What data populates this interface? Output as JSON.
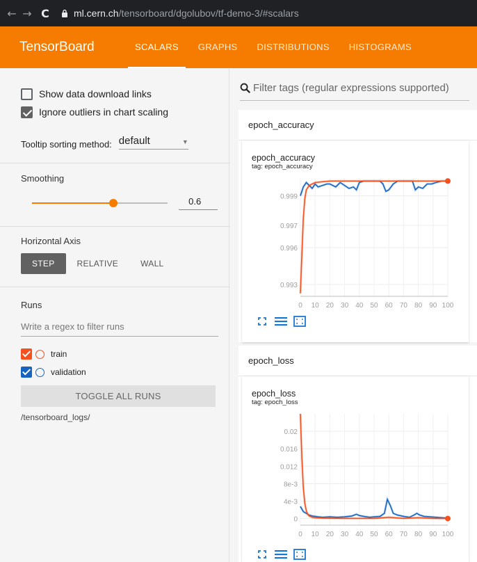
{
  "browser": {
    "back_icon": "←",
    "forward_icon": "→",
    "reload_icon": "C",
    "url_host": "ml.cern.ch",
    "url_path": "/tensorboard/dgolubov/tf-demo-3/#scalars"
  },
  "header": {
    "title": "TensorBoard",
    "tabs": [
      {
        "label": "SCALARS",
        "active": true
      },
      {
        "label": "GRAPHS",
        "active": false
      },
      {
        "label": "DISTRIBUTIONS",
        "active": false
      },
      {
        "label": "HISTOGRAMS",
        "active": false
      }
    ],
    "accent_color": "#f57c00"
  },
  "sidebar": {
    "show_download_links": {
      "label": "Show data download links",
      "checked": false
    },
    "ignore_outliers": {
      "label": "Ignore outliers in chart scaling",
      "checked": true
    },
    "tooltip_sorting": {
      "label": "Tooltip sorting method:",
      "value": "default"
    },
    "smoothing": {
      "label": "Smoothing",
      "value": "0.6",
      "fraction": 0.6
    },
    "horizontal_axis": {
      "label": "Horizontal Axis",
      "options": [
        {
          "label": "STEP",
          "active": true
        },
        {
          "label": "RELATIVE",
          "active": false
        },
        {
          "label": "WALL",
          "active": false
        }
      ]
    },
    "runs": {
      "label": "Runs",
      "filter_placeholder": "Write a regex to filter runs",
      "items": [
        {
          "name": "train",
          "color": "#f4511e",
          "checked": true
        },
        {
          "name": "validation",
          "color": "#1565c0",
          "checked": true
        }
      ],
      "toggle_label": "TOGGLE ALL RUNS",
      "logdir": "/tensorboard_logs/"
    }
  },
  "main": {
    "search_placeholder": "Filter tags (regular expressions supported)",
    "groups": [
      {
        "title": "epoch_accuracy",
        "chart_title": "epoch_accuracy",
        "chart_tag": "tag: epoch_accuracy"
      },
      {
        "title": "epoch_loss",
        "chart_title": "epoch_loss",
        "chart_tag": "tag: epoch_loss"
      }
    ]
  },
  "chart_data": [
    {
      "type": "line",
      "title": "epoch_accuracy",
      "subtitle": "tag: epoch_accuracy",
      "xlim": [
        0,
        100
      ],
      "x_ticks": [
        "0",
        "10",
        "20",
        "30",
        "40",
        "50",
        "60",
        "70",
        "80",
        "90",
        "100"
      ],
      "ylim": [
        0.9922,
        1.0002
      ],
      "y_ticks": [
        "0.999",
        "0.997",
        "0.996",
        "0.993"
      ],
      "y_tick_values": [
        0.999,
        0.997,
        0.9955,
        0.993
      ],
      "series": [
        {
          "name": "train",
          "color": "#f4511e",
          "x": [
            0,
            1,
            2,
            3,
            4,
            6,
            8,
            10,
            15,
            20,
            30,
            40,
            50,
            60,
            70,
            80,
            90,
            100
          ],
          "y": [
            0.9924,
            0.995,
            0.9975,
            0.9988,
            0.9994,
            0.9997,
            0.9998,
            0.9999,
            0.99995,
            1.0,
            1.0,
            1.0,
            1.0,
            1.0,
            1.0,
            1.0,
            1.0,
            1.0
          ]
        },
        {
          "name": "validation",
          "color": "#1565c0",
          "x": [
            0,
            2,
            4,
            6,
            8,
            10,
            12,
            15,
            18,
            20,
            24,
            27,
            30,
            33,
            36,
            38,
            40,
            43,
            47,
            50,
            54,
            56,
            58,
            60,
            63,
            66,
            70,
            73,
            76,
            78,
            80,
            83,
            86,
            89,
            92,
            96,
            100
          ],
          "y": [
            0.999,
            0.9996,
            0.9999,
            0.9997,
            0.9995,
            0.9998,
            0.9996,
            0.9997,
            0.9998,
            0.9998,
            0.9996,
            0.9999,
            0.9997,
            0.9995,
            0.9996,
            0.9994,
            0.9999,
            1.0,
            1.0,
            1.0,
            1.0,
            0.9998,
            0.9993,
            0.9994,
            0.9998,
            1.0,
            1.0,
            1.0,
            1.0,
            0.9994,
            0.9996,
            0.9995,
            0.9998,
            0.9998,
            0.9999,
            1.0,
            1.0
          ]
        }
      ]
    },
    {
      "type": "line",
      "title": "epoch_loss",
      "subtitle": "tag: epoch_loss",
      "xlim": [
        0,
        100
      ],
      "x_ticks": [
        "0",
        "10",
        "20",
        "30",
        "40",
        "50",
        "60",
        "70",
        "80",
        "90",
        "100"
      ],
      "ylim": [
        -0.0015,
        0.024
      ],
      "y_ticks": [
        "0.02",
        "0.016",
        "0.012",
        "8e-3",
        "4e-3",
        "0"
      ],
      "y_tick_values": [
        0.02,
        0.016,
        0.012,
        0.008,
        0.004,
        0.0
      ],
      "series": [
        {
          "name": "train",
          "color": "#f4511e",
          "x": [
            0,
            1,
            2,
            3,
            4,
            5,
            6,
            8,
            10,
            15,
            20,
            30,
            40,
            50,
            60,
            70,
            80,
            90,
            100
          ],
          "y": [
            0.024,
            0.014,
            0.007,
            0.0035,
            0.0018,
            0.001,
            0.0006,
            0.0003,
            0.0002,
            0.0001,
            8e-05,
            5e-05,
            5e-05,
            5e-05,
            0.0003,
            5e-05,
            0.0002,
            5e-05,
            2e-05
          ]
        },
        {
          "name": "validation",
          "color": "#1565c0",
          "x": [
            0,
            2,
            4,
            6,
            8,
            10,
            12,
            15,
            20,
            25,
            30,
            35,
            38,
            40,
            43,
            47,
            50,
            54,
            57,
            59,
            61,
            63,
            66,
            70,
            74,
            77,
            79,
            81,
            84,
            88,
            92,
            96,
            100
          ],
          "y": [
            0.0028,
            0.0016,
            0.0012,
            0.0008,
            0.0006,
            0.0005,
            0.0004,
            0.0003,
            0.0004,
            0.0003,
            0.0004,
            0.0006,
            0.001,
            0.0007,
            0.0005,
            0.0003,
            0.0004,
            0.0005,
            0.0012,
            0.0044,
            0.003,
            0.0012,
            0.0008,
            0.0005,
            0.0003,
            0.0008,
            0.0012,
            0.0008,
            0.0005,
            0.0004,
            0.0003,
            0.0002,
            0.0001
          ]
        }
      ]
    }
  ]
}
